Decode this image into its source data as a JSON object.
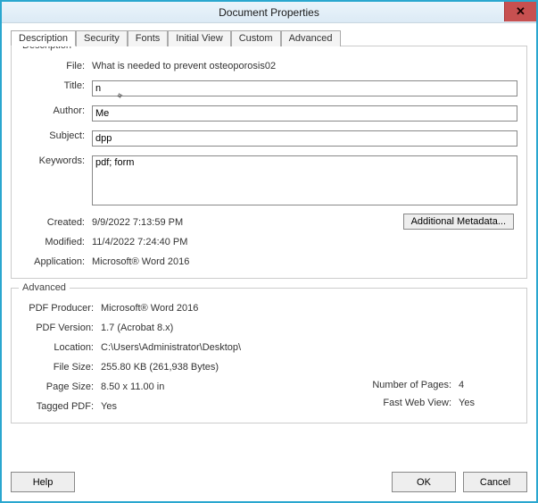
{
  "window": {
    "title": "Document Properties"
  },
  "tabs": {
    "description": "Description",
    "security": "Security",
    "fonts": "Fonts",
    "initialView": "Initial View",
    "custom": "Custom",
    "advanced": "Advanced"
  },
  "group": {
    "descriptionLegend": "Description",
    "advancedLegend": "Advanced"
  },
  "labels": {
    "file": "File:",
    "title": "Title:",
    "author": "Author:",
    "subject": "Subject:",
    "keywords": "Keywords:",
    "created": "Created:",
    "modified": "Modified:",
    "application": "Application:",
    "pdfProducer": "PDF Producer:",
    "pdfVersion": "PDF Version:",
    "location": "Location:",
    "fileSize": "File Size:",
    "pageSize": "Page Size:",
    "numberOfPages": "Number of Pages:",
    "taggedPdf": "Tagged PDF:",
    "fastWebView": "Fast Web View:"
  },
  "values": {
    "file": "What is needed to prevent osteoporosis02",
    "title": "n",
    "author": "Me",
    "subject": "dpp",
    "keywords": "pdf; form",
    "created": "9/9/2022 7:13:59 PM",
    "modified": "11/4/2022 7:24:40 PM",
    "application": "Microsoft® Word 2016",
    "pdfProducer": "Microsoft® Word 2016",
    "pdfVersion": "1.7 (Acrobat 8.x)",
    "location": "C:\\Users\\Administrator\\Desktop\\",
    "fileSize": "255.80 KB (261,938 Bytes)",
    "pageSize": "8.50 x 11.00 in",
    "numberOfPages": "4",
    "taggedPdf": "Yes",
    "fastWebView": "Yes"
  },
  "buttons": {
    "additionalMetadata": "Additional Metadata...",
    "help": "Help",
    "ok": "OK",
    "cancel": "Cancel"
  },
  "icons": {
    "close": "✕"
  }
}
